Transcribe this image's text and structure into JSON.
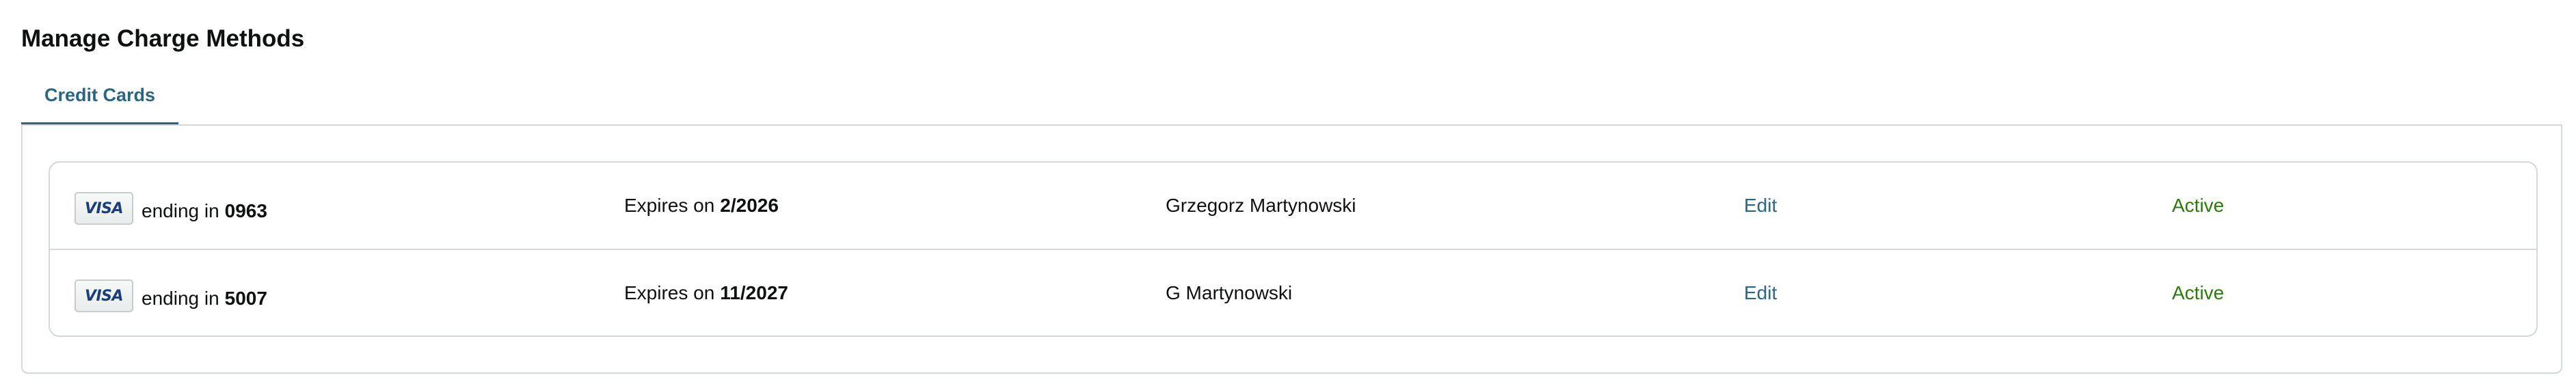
{
  "page": {
    "title": "Manage Charge Methods"
  },
  "tabs": [
    {
      "label": "Credit Cards",
      "active": true
    }
  ],
  "cards": [
    {
      "brand": "VISA",
      "brand_icon": "visa-card-icon",
      "ending_prefix": "ending in",
      "last4": "0963",
      "expires_prefix": "Expires on",
      "expiry": "2/2026",
      "holder": "Grzegorz Martynowski",
      "edit_label": "Edit",
      "status": "Active"
    },
    {
      "brand": "VISA",
      "brand_icon": "visa-card-icon",
      "ending_prefix": "ending in",
      "last4": "5007",
      "expires_prefix": "Expires on",
      "expiry": "11/2027",
      "holder": "G Martynowski",
      "edit_label": "Edit",
      "status": "Active"
    }
  ],
  "colors": {
    "link": "#2a6581",
    "status_active": "#2d7a0c",
    "border": "#d5d9d9",
    "visa_blue": "#1a3f7a"
  }
}
